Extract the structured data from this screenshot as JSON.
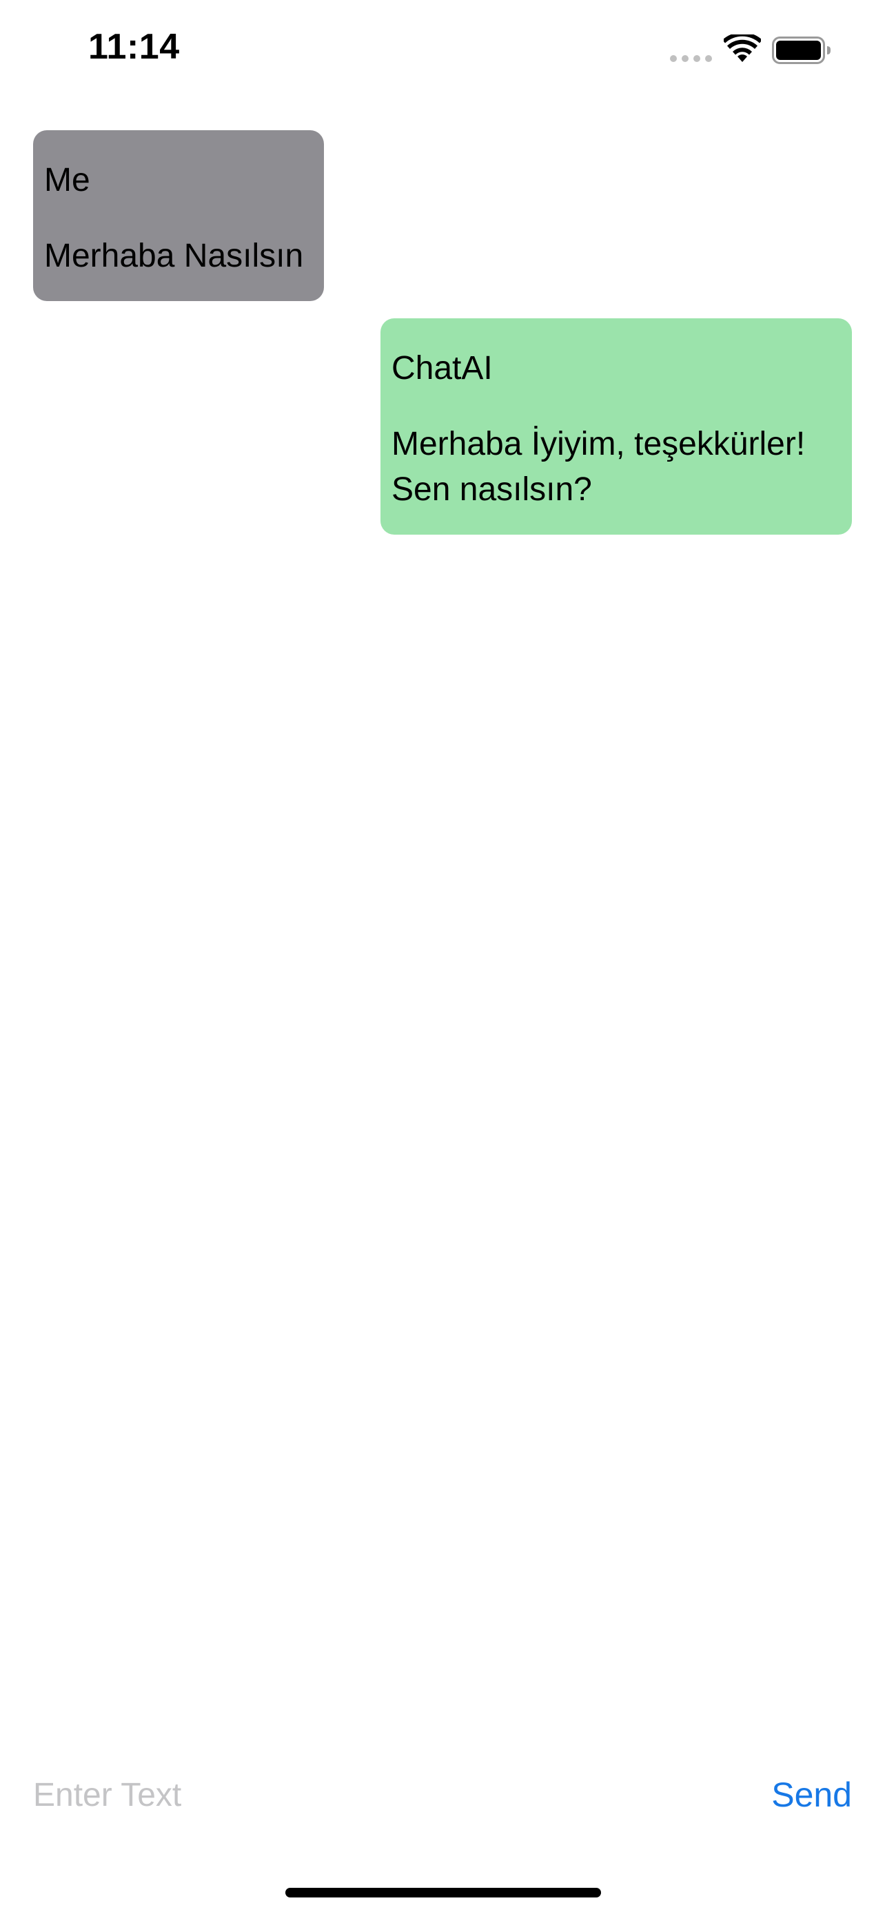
{
  "status_bar": {
    "time": "11:14",
    "icons": [
      "signal-dots-icon",
      "wifi-icon",
      "battery-icon"
    ]
  },
  "messages": [
    {
      "sender": "Me",
      "text": "Merhaba Nasılsın",
      "color": "#8e8d92"
    },
    {
      "sender": "ChatAI",
      "text": "Merhaba İyiyim, teşekkürler! Sen nasılsın?",
      "color": "#9be3ab"
    }
  ],
  "composer": {
    "placeholder": "Enter Text",
    "value": "",
    "send_label": "Send",
    "send_color": "#1778e6"
  }
}
